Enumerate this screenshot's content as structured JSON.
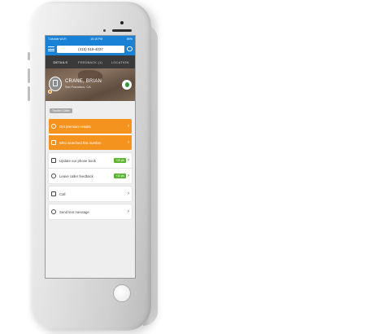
{
  "status_bar": {
    "carrier": "T-Mobile Wi-Fi",
    "time": "10:15 PM",
    "battery": "89%"
  },
  "header": {
    "phone_number": "(415) 519-4037"
  },
  "tabs": [
    {
      "label": "DETAILS",
      "active": true
    },
    {
      "label": "FEEDBACK (1)",
      "active": false
    },
    {
      "label": "LOCATION",
      "active": false
    }
  ],
  "caller": {
    "name": "CRANE, BRIAN",
    "location": "San Francisco, CA",
    "tag": "Trusted Caller"
  },
  "actions_primary": [
    {
      "label": "Get premium results",
      "icon": "search-icon"
    },
    {
      "label": "Who searched this number",
      "icon": "question-icon"
    }
  ],
  "actions_secondary": [
    {
      "label": "Update our phone book",
      "icon": "book-icon",
      "pill": "+25 pts"
    },
    {
      "label": "Leave caller feedback",
      "icon": "feedback-icon",
      "pill": "+10 pts"
    }
  ],
  "actions_contact": [
    {
      "label": "Call",
      "icon": "phone-icon"
    },
    {
      "label": "Send text message",
      "icon": "message-icon"
    }
  ],
  "colors": {
    "accent": "#1a82d6",
    "orange": "#f5931f",
    "green": "#5cb531",
    "dark": "#3a3a3a"
  }
}
